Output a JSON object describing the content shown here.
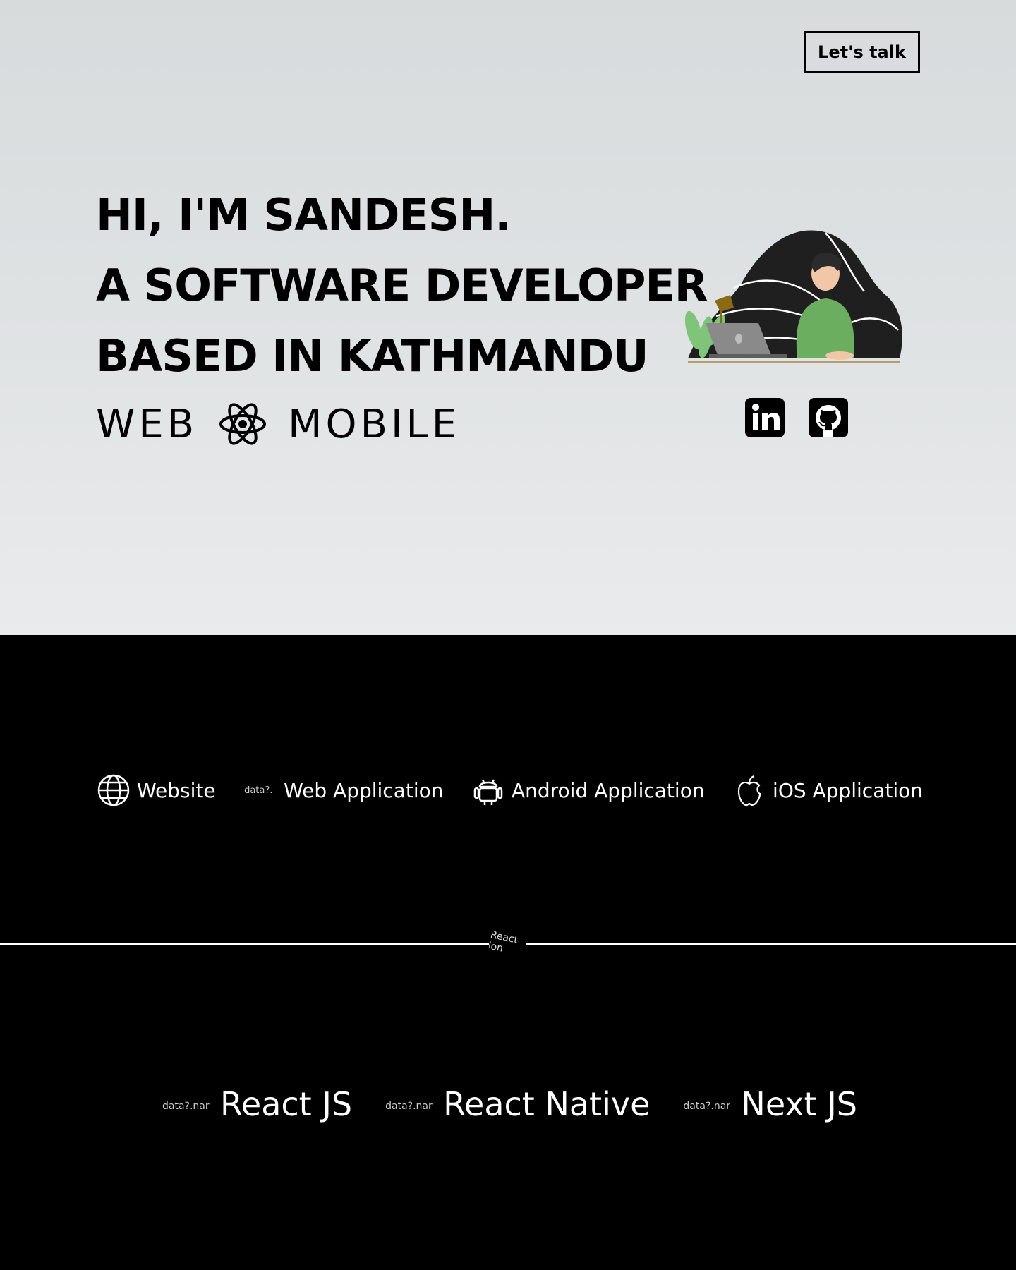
{
  "header": {
    "cta_label": "Let's talk"
  },
  "hero": {
    "line1": "HI, I'M SANDESH.",
    "line2": "A SOFTWARE DEVELOPER",
    "line3": "BASED IN KATHMANDU",
    "tag_left": "WEB",
    "tag_right": "MOBILE",
    "tag_icon": "react-atom-icon",
    "illustration": "developer-at-laptop-illustration",
    "socials": [
      {
        "icon": "linkedin-icon"
      },
      {
        "icon": "github-icon"
      }
    ]
  },
  "services": {
    "items": [
      {
        "label": "Website",
        "icon": "globe-icon"
      },
      {
        "label": "Web Application",
        "icon": "broken-image",
        "alt": "data?."
      },
      {
        "label": "Android Application",
        "icon": "android-icon"
      },
      {
        "label": "iOS Application",
        "icon": "apple-icon"
      }
    ],
    "divider_logo_alt": "React ion"
  },
  "tech": {
    "items": [
      {
        "label": "React JS",
        "alt": "data?.nar"
      },
      {
        "label": "React Native",
        "alt": "data?.nar"
      },
      {
        "label": "Next JS",
        "alt": "data?.nar"
      }
    ]
  },
  "colors": {
    "hero_bg_top": "#d7dbdc",
    "hero_bg_bottom": "#eaebec",
    "dark_bg": "#000000",
    "text_light": "#ffffff",
    "illustration_shirt": "#6cae5f",
    "illustration_blob": "#1f1f1f"
  }
}
